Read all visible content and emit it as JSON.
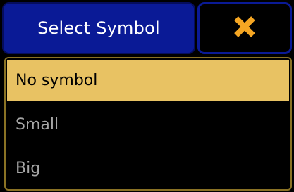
{
  "dialog": {
    "title": "Select Symbol",
    "close_icon": "close-x-icon",
    "accent_color": "#0a1a96",
    "close_icon_color": "#f5a623",
    "panel_border_color": "#8a7224"
  },
  "options": [
    {
      "label": "No symbol",
      "selected": true
    },
    {
      "label": "Small",
      "selected": false
    },
    {
      "label": "Big",
      "selected": false
    }
  ],
  "colors": {
    "selected_background": "#e8c263",
    "selected_text": "#000000",
    "item_text": "#a6a6a6",
    "background": "#000000"
  }
}
